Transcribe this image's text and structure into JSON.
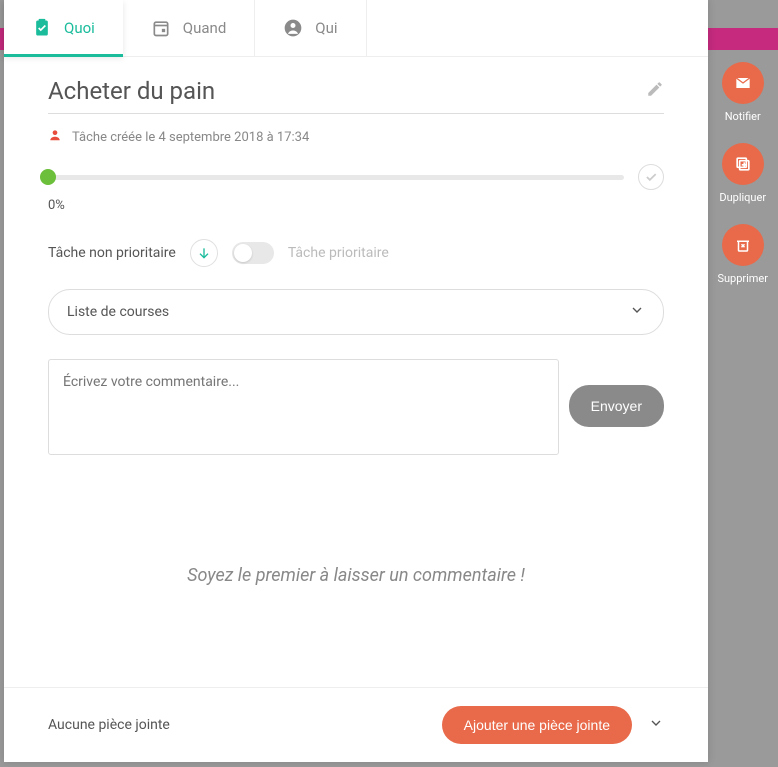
{
  "tabs": {
    "quoi": "Quoi",
    "quand": "Quand",
    "qui": "Qui"
  },
  "task": {
    "title": "Acheter du pain",
    "created_meta": "Tâche créée le 4 septembre 2018 à 17:34",
    "progress_pct": "0%"
  },
  "priority": {
    "low_label": "Tâche non prioritaire",
    "high_label": "Tâche prioritaire"
  },
  "list_select": {
    "selected": "Liste de courses"
  },
  "comment": {
    "placeholder": "Écrivez votre commentaire...",
    "send": "Envoyer",
    "empty": "Soyez le premier à laisser un commentaire !"
  },
  "attachment": {
    "none_label": "Aucune pièce jointe",
    "add_label": "Ajouter une pièce jointe"
  },
  "side": {
    "notify": "Notifier",
    "duplicate": "Dupliquer",
    "delete": "Supprimer"
  },
  "colors": {
    "accent": "#1abc9c",
    "action": "#e86a4a",
    "progress": "#6bbf3a"
  }
}
